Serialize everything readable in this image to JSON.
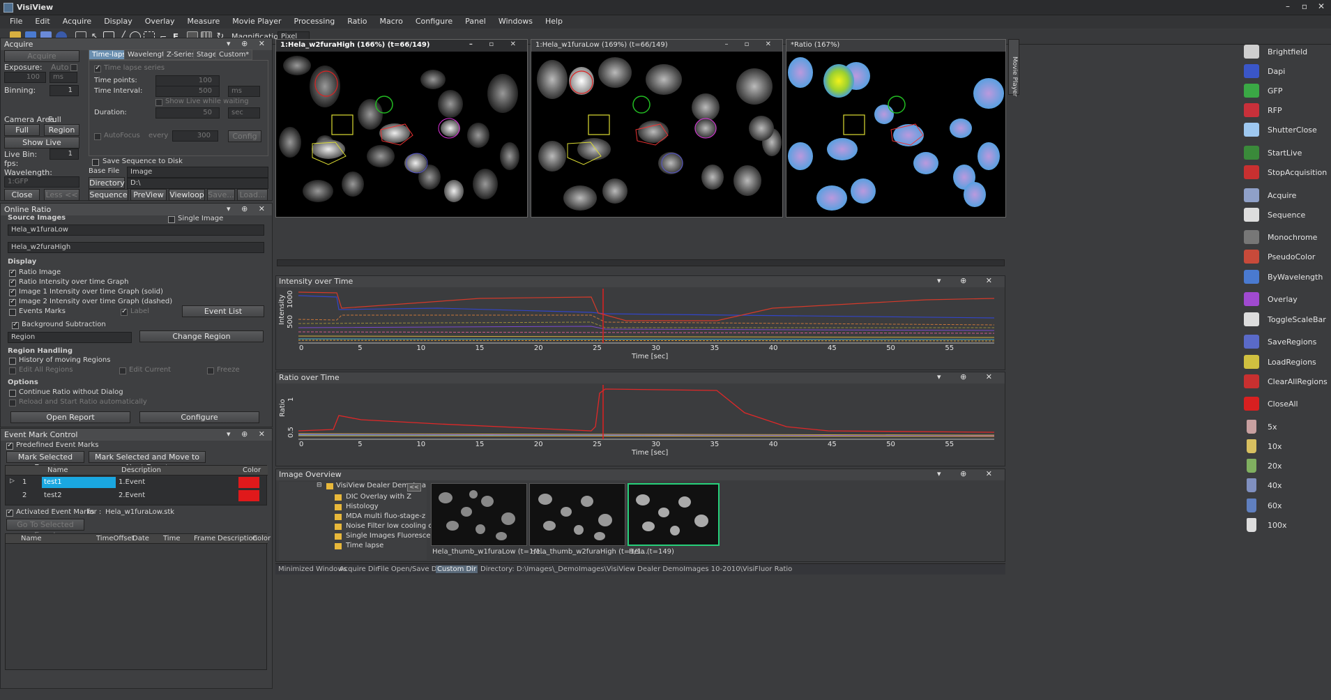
{
  "app": {
    "title": "VisiView"
  },
  "menu": [
    "File",
    "Edit",
    "Acquire",
    "Display",
    "Overlay",
    "Measure",
    "Movie Player",
    "Processing",
    "Ratio",
    "Macro",
    "Configure",
    "Panel",
    "Windows",
    "Help"
  ],
  "toolbar": {
    "magnification_label": "Magnification",
    "magnification_value": "Pixel"
  },
  "acquire": {
    "title": "Acquire",
    "acquire_btn": "Acquire",
    "exposure_label": "Exposure:",
    "auto_label": "Auto",
    "exposure_value": "100",
    "exposure_unit": "ms",
    "binning_label": "Binning:",
    "binning_value": "1",
    "tabs": [
      "Time-lapse",
      "Wavelength",
      "Z-Series",
      "Stage",
      "Custom*"
    ],
    "time_lapse_series": "Time lapse series",
    "time_points_label": "Time points:",
    "time_points_value": "100",
    "time_interval_label": "Time Interval:",
    "time_interval_value": "500",
    "time_interval_unit": "ms",
    "show_live_waiting": "Show Live while waiting",
    "duration_label": "Duration:",
    "duration_value": "50",
    "duration_unit": "sec",
    "autofocus": "AutoFocus",
    "every": "every",
    "every_value": "300",
    "config_btn": "Config",
    "camera_area_label": "Camera Area:",
    "camera_area_value": "Full",
    "full_btn": "Full",
    "region_btn": "Region",
    "show_live_btn": "Show Live",
    "live_bin_label": "Live Bin:",
    "live_bin_value": "1",
    "fps_label": "fps:",
    "wavelength_label": "Wavelength:",
    "wavelength_value": "1:GFP",
    "save_seq": "Save Sequence to Disk",
    "base_file_label": "Base File",
    "base_file_value": "Image",
    "directory_btn": "Directory",
    "directory_value": "D:\\",
    "close_btn": "Close",
    "less_btn": "Less <<",
    "sequence_btn": "Sequence",
    "preview_btn": "PreView",
    "viewloop_btn": "Viewloop",
    "save_btn": "Save...",
    "load_btn": "Load..."
  },
  "online_ratio": {
    "title": "Online Ratio",
    "source_images": "Source Images",
    "single_image": "Single Image",
    "source1": "Hela_w1furaLow",
    "source2": "Hela_w2furaHigh",
    "display": "Display",
    "opts": [
      "Ratio Image",
      "Ratio Intensity over time Graph",
      "Image 1 Intensity over time Graph (solid)",
      "Image 2 Intensity over time Graph (dashed)",
      "Events Marks"
    ],
    "label_opt": "Label",
    "event_list_btn": "Event List",
    "background_sub": "Background Subtraction",
    "bg_value": "Region",
    "change_region_btn": "Change Region",
    "region_handling": "Region Handling",
    "history_moving": "History of moving Regions",
    "edit_all": "Edit All Regions",
    "edit_current": "Edit Current",
    "freeze": "Freeze",
    "options": "Options",
    "continue_ratio": "Continue Ratio without Dialog",
    "reload_ratio": "Reload and Start Ratio automatically",
    "open_report_btn": "Open Report",
    "configure_btn": "Configure"
  },
  "event_mark": {
    "title": "Event Mark Control",
    "predefined": "Predefined Event Marks",
    "mark_selected_btn": "Mark Selected Event",
    "mark_next_btn": "Mark Selected and Move to Next Event",
    "columns": [
      "Name",
      "Description",
      "Color"
    ],
    "rows": [
      {
        "num": "1",
        "name": "test1",
        "desc": "1.Event",
        "color": "#e0191b"
      },
      {
        "num": "2",
        "name": "test2",
        "desc": "2.Event",
        "color": "#e0191b"
      }
    ],
    "activated": "Activated Event Marks",
    "for_label": "for :",
    "for_value": "Hela_w1furaLow.stk",
    "goto_btn": "Go To Selected Event",
    "columns2": [
      "Name",
      "TimeOffset",
      "Date",
      "Time",
      "Frame",
      "Description",
      "Color"
    ]
  },
  "images": [
    {
      "title": "1:Hela_w2furaHigh (166%) (t=66/149)"
    },
    {
      "title": "1:Hela_w1furaLow (169%) (t=66/149)"
    },
    {
      "title": "*Ratio (167%)"
    }
  ],
  "intensity_graph": {
    "title": "Intensity over Time",
    "ylabel": "Intensity",
    "xlabel": "Time [sec]",
    "yticks": [
      "1000",
      "500"
    ],
    "xticks": [
      "0",
      "5",
      "10",
      "15",
      "20",
      "25",
      "30",
      "35",
      "40",
      "45",
      "50",
      "55"
    ]
  },
  "ratio_graph": {
    "title": "Ratio over Time",
    "ylabel": "Ratio",
    "xlabel": "Time [sec]",
    "yticks": [
      "1",
      "0.5"
    ],
    "xticks": [
      "0",
      "5",
      "10",
      "15",
      "20",
      "25",
      "30",
      "35",
      "40",
      "45",
      "50",
      "55"
    ]
  },
  "overview": {
    "title": "Image Overview",
    "root": "VisiView Dealer DemoIma",
    "folders": [
      "DIC Overlay with Z",
      "Histology",
      "MDA multi fluo-stage-z",
      "Noise Filter low cooling car",
      "Single Images Fluorescens",
      "Time lapse"
    ],
    "thumbs": [
      "Hela_thumb_w1furaLow (t=1/1...",
      "Hela_thumb_w2furaHigh (t=1/1...",
      "Hela (t=149)"
    ]
  },
  "bottom": {
    "tabs": [
      "Minimized Windows",
      "Acquire Dir",
      "File Open/Save Dir",
      "Custom Dir"
    ],
    "directory": "Directory: D:\\Images\\_DemoImages\\VisiView Dealer DemoImages 10-2010\\VisiFluor Ratio"
  },
  "side_tab": "Movie Player",
  "right_toolbar": [
    {
      "label": "Brightfield",
      "icon": "brightfield-icon",
      "color": "#cfcfcf"
    },
    {
      "label": "Dapi",
      "icon": "dapi-icon",
      "color": "#3a56c8"
    },
    {
      "label": "GFP",
      "icon": "gfp-icon",
      "color": "#3aa845"
    },
    {
      "label": "RFP",
      "icon": "rfp-icon",
      "color": "#c8303a"
    },
    {
      "label": "ShutterClose",
      "icon": "shutter-close-icon",
      "color": "#9ec8f0"
    },
    {
      "label": "StartLive",
      "icon": "start-live-icon",
      "color": "#3a8a3a"
    },
    {
      "label": "StopAcquisition",
      "icon": "stop-acquisition-icon",
      "color": "#c83030"
    },
    {
      "label": "Acquire",
      "icon": "acquire-icon",
      "color": "#8fa0c8"
    },
    {
      "label": "Sequence",
      "icon": "sequence-icon",
      "color": "#dddddd"
    },
    {
      "label": "Monochrome",
      "icon": "monochrome-icon",
      "color": "#777777"
    },
    {
      "label": "PseudoColor",
      "icon": "pseudocolor-icon",
      "color": "#c84a3a"
    },
    {
      "label": "ByWavelength",
      "icon": "by-wavelength-icon",
      "color": "#4a7ad0"
    },
    {
      "label": "Overlay",
      "icon": "overlay-icon",
      "color": "#a04ad0"
    },
    {
      "label": "ToggleScaleBar",
      "icon": "toggle-scalebar-icon",
      "color": "#dddddd"
    },
    {
      "label": "SaveRegions",
      "icon": "save-regions-icon",
      "color": "#5a6ac8"
    },
    {
      "label": "LoadRegions",
      "icon": "load-regions-icon",
      "color": "#d0c040"
    },
    {
      "label": "ClearAllRegions",
      "icon": "clear-regions-icon",
      "color": "#c83030"
    },
    {
      "label": "CloseAll",
      "icon": "close-all-icon",
      "color": "#d82020"
    },
    {
      "label": "5x",
      "icon": "objective-5x-icon",
      "color": "#c8a0a0"
    },
    {
      "label": "10x",
      "icon": "objective-10x-icon",
      "color": "#d8c060"
    },
    {
      "label": "20x",
      "icon": "objective-20x-icon",
      "color": "#80b060"
    },
    {
      "label": "40x",
      "icon": "objective-40x-icon",
      "color": "#8090c0"
    },
    {
      "label": "60x",
      "icon": "objective-60x-icon",
      "color": "#6080c0"
    },
    {
      "label": "100x",
      "icon": "objective-100x-icon",
      "color": "#dddddd"
    }
  ]
}
